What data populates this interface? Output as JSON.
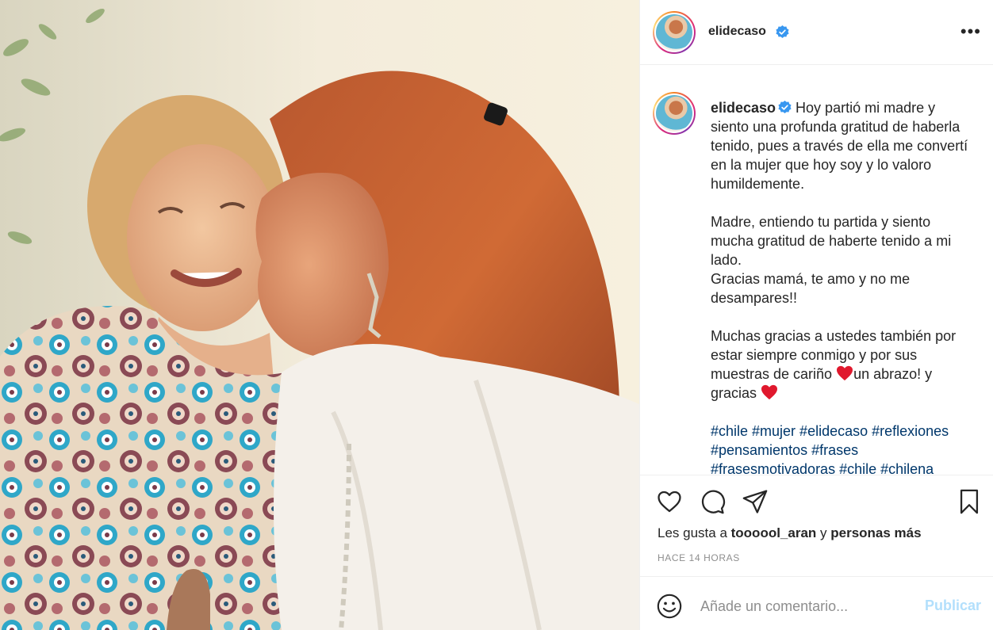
{
  "post": {
    "username": "elidecaso",
    "verified": true,
    "more_icon": "more-horizontal-icon"
  },
  "caption": {
    "username": "elidecaso",
    "paragraphs": [
      "Hoy partió mi madre y siento una profunda gratitud de haberla tenido, pues a través de ella me convertí en la mujer que hoy soy y lo valoro humildemente.",
      "Madre, entiendo tu partida y siento mucha gratitud de haberte tenido a mi lado.",
      "Gracias mamá, te amo y no me desampares!!",
      "Muchas gracias a ustedes también por estar siempre conmigo y por sus muestras de cariño",
      "un abrazo! y gracias"
    ],
    "hashtags": "#chile #mujer #elidecaso #reflexiones #pensamientos #frases #frasesmotivadoras #chile #chilena"
  },
  "actions": {
    "like_icon": "heart-outline-icon",
    "comment_icon": "comment-bubble-icon",
    "share_icon": "paper-plane-icon",
    "save_icon": "bookmark-icon"
  },
  "likes": {
    "prefix": "Les gusta a ",
    "user": "toooool_aran",
    "middle": " y ",
    "others": "personas más"
  },
  "timestamp": "HACE 14 HORAS",
  "comment": {
    "emoji_icon": "smiley-face-icon",
    "placeholder": "Añade un comentario...",
    "publish_label": "Publicar"
  },
  "colors": {
    "link": "#00376b",
    "publish_disabled": "#b2dffc",
    "verified": "#3897f0",
    "heart": "#e0182d"
  }
}
